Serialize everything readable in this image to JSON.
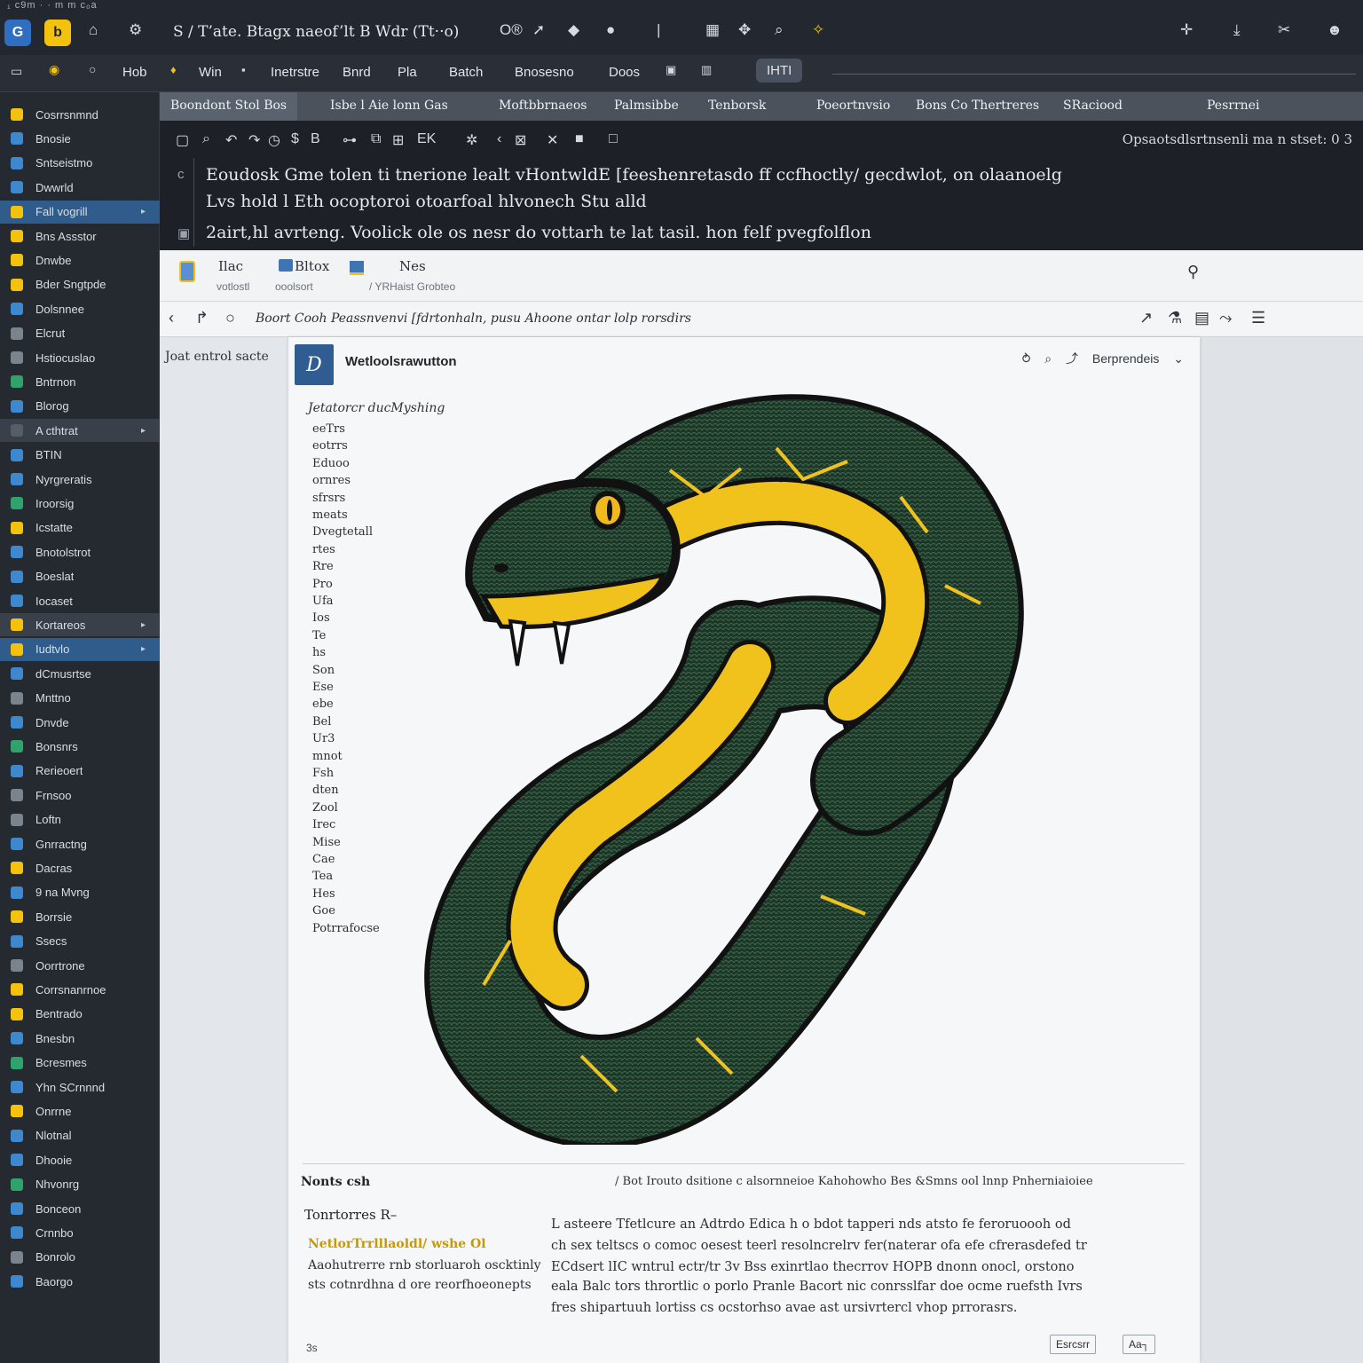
{
  "titlebar": {
    "crumb": "₁  c9m   · · m m   c₀a",
    "title": "S  ∕  T’ate.   Btagx naeof’lt B  Wdr (Tt··o)",
    "right_text": "O®"
  },
  "menubar": {
    "items": [
      "Hob",
      "Win",
      "Inetrstre",
      "Bnrd",
      "Pla",
      "Batch",
      "Bnosesno",
      "Doos",
      "IHTI"
    ],
    "active": "IHTI"
  },
  "sidebar": {
    "items": [
      {
        "label": "Cosrrsnmnd",
        "color": "#f4c20d"
      },
      {
        "label": "Bnosie",
        "color": "#3e88cf"
      },
      {
        "label": "Sntseistmo",
        "color": "#3e88cf"
      },
      {
        "label": "Dwwrld",
        "color": "#3e88cf"
      },
      {
        "label": "Fall vogrill",
        "color": "#f4c20d"
      },
      {
        "label": "Bns Assstor",
        "color": "#f4c20d"
      },
      {
        "label": "Dnwbe",
        "color": "#f4c20d"
      },
      {
        "label": "Bder Sngtpde",
        "color": "#f4c20d"
      },
      {
        "label": "Dolsnnee",
        "color": "#3e88cf"
      },
      {
        "label": "Elcrut",
        "color": "#7a848f"
      },
      {
        "label": "Hstiocuslao",
        "color": "#7a848f"
      },
      {
        "label": "Bntrnon",
        "color": "#2fa36b"
      },
      {
        "label": "Blorog",
        "color": "#3e88cf"
      },
      {
        "label": "A cthtrat",
        "color": "#555d68"
      },
      {
        "label": "BTIN",
        "color": "#3e88cf"
      },
      {
        "label": "Nyrgreratis",
        "color": "#3e88cf"
      },
      {
        "label": "Iroorsig",
        "color": "#2fa36b"
      },
      {
        "label": "Icstatte",
        "color": "#f4c20d"
      },
      {
        "label": "Bnotolstrot",
        "color": "#3e88cf"
      },
      {
        "label": "Boeslat",
        "color": "#3e88cf"
      },
      {
        "label": "Iocaset",
        "color": "#3e88cf"
      },
      {
        "label": "Kortareos",
        "color": "#f4c20d"
      },
      {
        "label": "Iudtvlo",
        "color": "#f4c20d"
      },
      {
        "label": "dCmusrtse",
        "color": "#3e88cf"
      },
      {
        "label": "Mnttno",
        "color": "#7a848f"
      },
      {
        "label": "Dnvde",
        "color": "#3e88cf"
      },
      {
        "label": "Bonsnrs",
        "color": "#2fa36b"
      },
      {
        "label": "Rerieoert",
        "color": "#3e88cf"
      },
      {
        "label": "Frnsoo",
        "color": "#7a848f"
      },
      {
        "label": "Loftn",
        "color": "#7a848f"
      },
      {
        "label": "Gnrractng",
        "color": "#3e88cf"
      },
      {
        "label": "Dacras",
        "color": "#f4c20d"
      },
      {
        "label": "9 na Mvng",
        "color": "#3e88cf"
      },
      {
        "label": "Borrsie",
        "color": "#f4c20d"
      },
      {
        "label": "Ssecs",
        "color": "#3e88cf"
      },
      {
        "label": "Oorrtrone",
        "color": "#7a848f"
      },
      {
        "label": "Corrsnanrnoe",
        "color": "#f4c20d"
      },
      {
        "label": "Bentrado",
        "color": "#f4c20d"
      },
      {
        "label": "Bnesbn",
        "color": "#3e88cf"
      },
      {
        "label": "Bcresmes",
        "color": "#2fa36b"
      },
      {
        "label": "Yhn SCrnnnd",
        "color": "#3e88cf"
      },
      {
        "label": "Onrrne",
        "color": "#f4c20d"
      },
      {
        "label": "Nlotnal",
        "color": "#3e88cf"
      },
      {
        "label": "Dhooie",
        "color": "#3e88cf"
      },
      {
        "label": "Nhvonrg",
        "color": "#2fa36b"
      },
      {
        "label": "Bonceon",
        "color": "#3e88cf"
      },
      {
        "label": "Crnnbo",
        "color": "#3e88cf"
      },
      {
        "label": "Bonrolo",
        "color": "#7a848f"
      },
      {
        "label": "Baorgo",
        "color": "#3e88cf"
      }
    ]
  },
  "tabs": [
    "Boondont Stol  Bos",
    "Isbe  l Aie lonn Gas",
    "Moftbbrnaeos",
    "Palmsibbe",
    "Tenborsk",
    "Poeortnvsio",
    "Bons Co Thertreres",
    "SRaciood",
    "Pesrrnei"
  ],
  "editor": {
    "right_text": "Opsaotsdlsrtnsenli  ma  n  stset:  0  3",
    "lines": [
      "Eoudosk  Gme  tolen  ti  tnerione  lealt  vHontwldE  [feeshenretasdo  ff  ccfhoctly/  gecdwlot,  on  olaanoelg",
      "Lvs  hold  l  Eth  ocoptoroi  otoarfoal  hlvonech  Stu  alld",
      "2airt,hl  avrteng.  Voolick  ole  os  nesr  do  vottarh  te  lat  tasil.  hon  felf  pvegfolflon"
    ]
  },
  "pane": {
    "top_labels": [
      {
        "label": "Ilac",
        "sub": "votlostl"
      },
      {
        "label": "Bltox",
        "sub": "ooolsort"
      },
      {
        "label": "Nes",
        "sub": "/  YRHaist  Grobteo"
      }
    ],
    "address": "Boort  Cooh  Peassnvenvi  [fdrtonhaln,  pusu  Ahoone  ontar  lolp  rorsdirs",
    "left_label": "Joat  entrol  sacte",
    "doc_title": "Wetloolsrawutton",
    "doc_logo": "D",
    "doc_tools": [
      "⥁",
      "⌕",
      "⤴",
      "Berprendeis",
      "⌄"
    ],
    "list_head": "Jetatorcr  ducMyshing",
    "list_items": [
      "eeTrs",
      "eotrrs",
      "Eduoo",
      "ornres",
      "sfrsrs",
      "meats",
      "Dvegtetall",
      "rtes",
      "Rre",
      "Pro",
      "Ufa",
      "Ios",
      "Te",
      "hs",
      "Son",
      "Ese",
      "ebe",
      "Bel",
      "Ur3",
      "mnot",
      "Fsh",
      "dten",
      "Zool",
      "Irec",
      "Mise",
      "Cae",
      "Tea",
      "Hes",
      "Goe",
      "Potrrafocse"
    ],
    "notes": {
      "title": "Nonts  csh",
      "links": "/  Bot  Irouto  dsitione    c  alsornneioe  Kahohowho  Bes  &Smns  ool  lnnp  Pnherniaioiee",
      "subtitle": "Tonrtorres  R–",
      "highlight": "NetlorTrrlllaoldl/  wshe  Ol",
      "left_lines": [
        "Aaohutrerre  rnb  storluaroh  oscktinly",
        "sts  cotnrdhna  d  ore  reorfhoeonepts"
      ],
      "body_lines": [
        "L  asteere  Tfetlcure  an  Adtrdo  Edica  h  o  bdot  tapperi  nds  atsto  fe  feroruoooh  od",
        "ch  sex  teltscs  o  comoc  oesest  teerl  resolncrelrv  fer(naterar  ofa  efe  cfrerasdefed  tr",
        "ECdsert  lIC  wntrul  ectr/tr  3v  Bss  exinrtlao  thecrrov  HOPB  dnonn  onocl,  orstono",
        "eala  Balc  tors  thrortlic  o  porlo  Pranle  Bacort  nic  conrsslfar  doe  ocme  ruefsth  Ivrs",
        "fres  shipartuuh  lortiss  cs  ocstorhso  avae  ast  ursivrtercl  vhop  prrorasrs."
      ],
      "footer": "3s",
      "buttons": [
        "Esrcsrr",
        "Aa┐"
      ]
    }
  },
  "colors": {
    "accent_blue": "#2f5c8a",
    "accent_yellow": "#f4c20d",
    "snake_green": "#1f3b2c",
    "snake_yellow": "#f1c21b"
  }
}
